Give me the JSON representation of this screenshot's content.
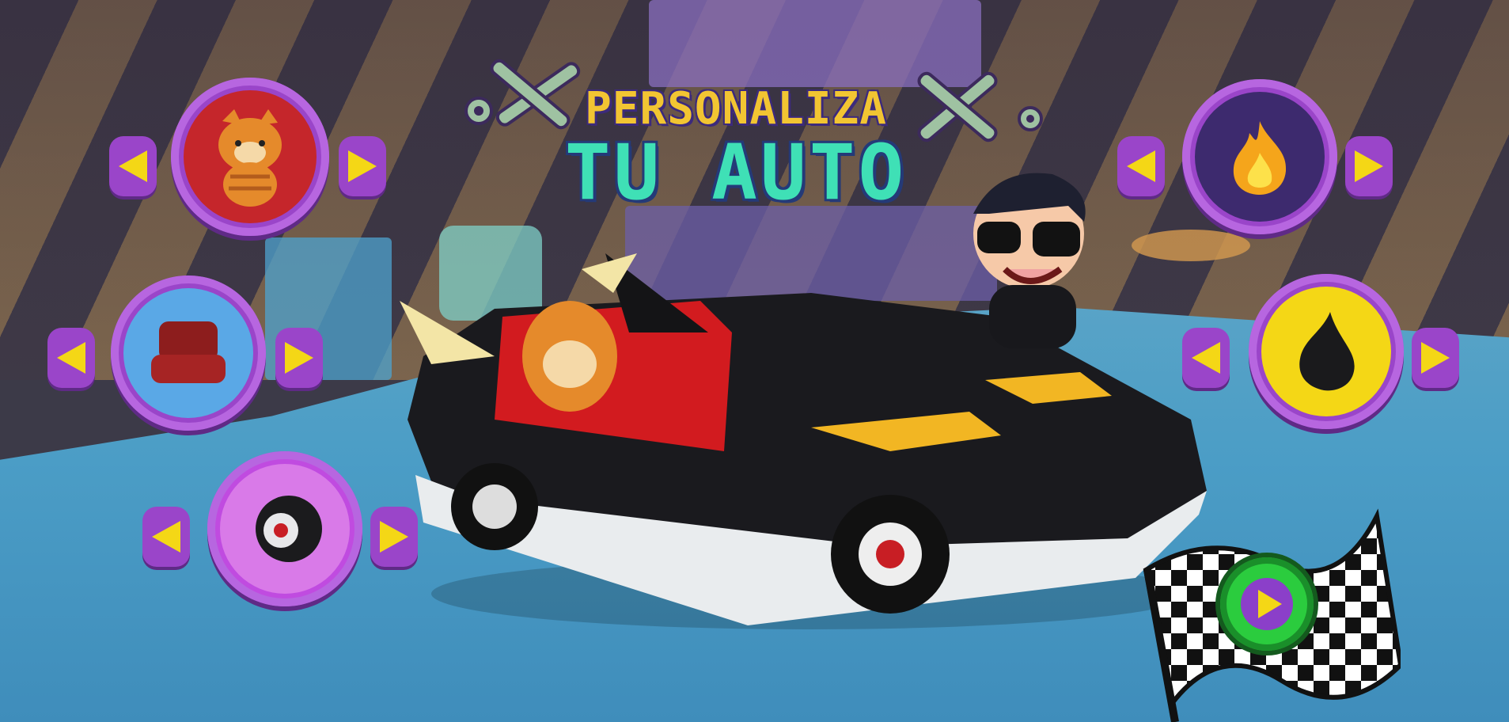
{
  "title": {
    "line1": "PERSONALIZA",
    "line2": "TU AUTO"
  },
  "left_selectors": [
    {
      "name": "passenger",
      "icon": "tiger-plush-icon",
      "ring_color": "#9a45c9",
      "fill": "#c5262b"
    },
    {
      "name": "seat",
      "icon": "car-seat-icon",
      "ring_color": "#9a45c9",
      "fill": "#5aa8e6"
    },
    {
      "name": "wheels",
      "icon": "wheel-icon",
      "ring_color": "#c04be0",
      "fill": "#d97ae8"
    }
  ],
  "right_selectors": [
    {
      "name": "decal",
      "icon": "flame-icon",
      "fill": "#3d2a6e"
    },
    {
      "name": "paint",
      "icon": "paint-drop-icon",
      "fill": "#f4d716"
    }
  ],
  "play": {
    "icon": "play-icon",
    "flag": "checkered-flag-icon"
  },
  "colors": {
    "accent_purple": "#9a45c9",
    "arrow_yellow": "#f4d716",
    "play_green": "#2bcc3e"
  }
}
